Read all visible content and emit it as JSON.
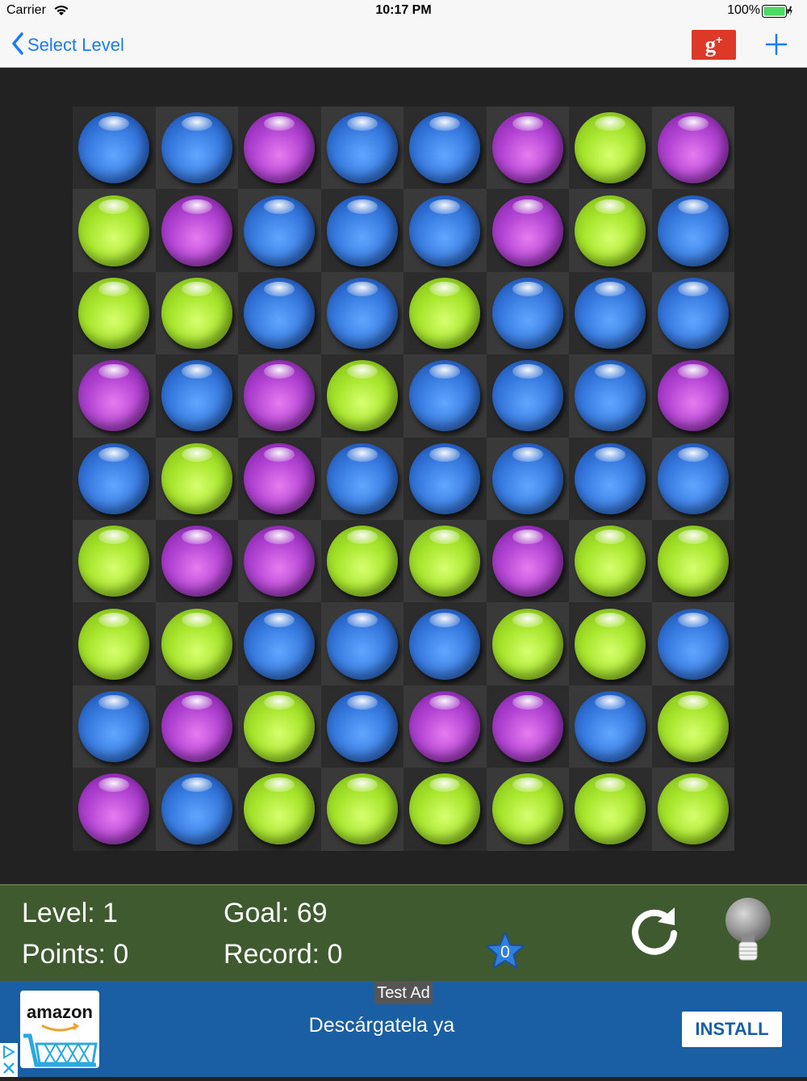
{
  "status_bar": {
    "carrier": "Carrier",
    "time": "10:17 PM",
    "battery": "100%"
  },
  "nav": {
    "back_label": "Select Level",
    "gplus_label": "g",
    "gplus_sup": "+"
  },
  "board": {
    "rows": [
      [
        "blue",
        "blue",
        "purple",
        "blue",
        "blue",
        "purple",
        "green",
        "purple"
      ],
      [
        "green",
        "purple",
        "blue",
        "blue",
        "blue",
        "purple",
        "green",
        "blue"
      ],
      [
        "green",
        "green",
        "blue",
        "blue",
        "green",
        "blue",
        "blue",
        "blue"
      ],
      [
        "purple",
        "blue",
        "purple",
        "green",
        "blue",
        "blue",
        "blue",
        "purple"
      ],
      [
        "blue",
        "green",
        "purple",
        "blue",
        "blue",
        "blue",
        "blue",
        "blue"
      ],
      [
        "green",
        "purple",
        "purple",
        "green",
        "green",
        "purple",
        "green",
        "green"
      ],
      [
        "green",
        "green",
        "blue",
        "blue",
        "blue",
        "green",
        "green",
        "blue"
      ],
      [
        "blue",
        "purple",
        "green",
        "blue",
        "purple",
        "purple",
        "blue",
        "green"
      ],
      [
        "purple",
        "blue",
        "green",
        "green",
        "green",
        "green",
        "green",
        "green"
      ]
    ]
  },
  "info": {
    "level": "Level: 1",
    "goal": "Goal: 69",
    "points": "Points: 0",
    "record": "Record: 0",
    "stars": "0"
  },
  "ad": {
    "test_label": "Test Ad",
    "brand": "amazon",
    "headline": "Descárgatela ya",
    "install_label": "INSTALL"
  },
  "colors": {
    "accent": "#1a7cf5",
    "panel": "#3f5a2f",
    "ad_bg": "#1a5fa3",
    "gplus": "#dc3928"
  }
}
